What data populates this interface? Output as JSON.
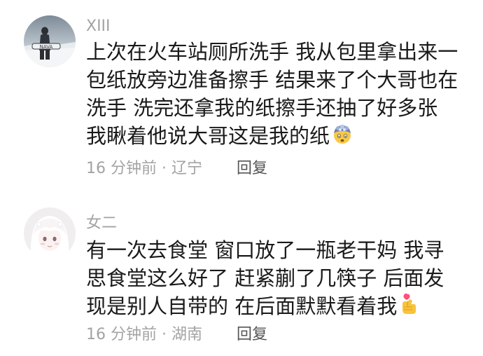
{
  "comments": [
    {
      "username": "XIII",
      "lines": [
        "上次在火车站厕所洗手 我从包里拿出来一",
        "包纸放旁边准备擦手 结果来了个大哥也在",
        "洗手 洗完还拿我的纸擦手还抽了好多张",
        "我瞅着他说大哥这是我的纸"
      ],
      "emoji": "mind-blown-emoji",
      "time": "16 分钟前",
      "location": "辽宁",
      "reply_label": "回复"
    },
    {
      "username": "女二",
      "lines": [
        "有一次去食堂 窗口放了一瓶老干妈 我寻",
        "思食堂这么好了 赶紧蒯了几筷子 后面发",
        "现是别人自带的 在后面默默看着我"
      ],
      "emoji": "finger-heart-emoji",
      "time": "16 分钟前",
      "location": "湖南",
      "reply_label": "回复"
    }
  ],
  "separator": " · "
}
